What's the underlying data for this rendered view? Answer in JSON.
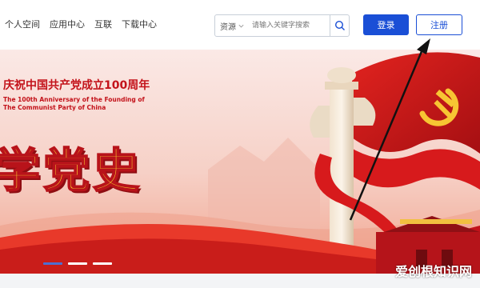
{
  "nav": {
    "items": [
      {
        "label": "个人空间"
      },
      {
        "label": "应用中心"
      },
      {
        "label": "互联"
      },
      {
        "label": "下载中心"
      }
    ]
  },
  "search": {
    "category": "资源",
    "placeholder": "请输入关键字搜索",
    "icon": "search-icon"
  },
  "auth": {
    "login_label": "登录",
    "register_label": "注册"
  },
  "banner": {
    "title": "庆祝中国共产党成立100周年",
    "english_line1": "The 100th Anniversary of the Founding of",
    "english_line2": "The Communist Party of China",
    "slogan": "学党史",
    "carousel_count": 3,
    "active_slide": 1
  },
  "watermark": "爱创根知识网",
  "colors": {
    "primary": "#1a4fd6",
    "banner_red": "#c3121a",
    "slogan_gold": "#f6c22c"
  }
}
